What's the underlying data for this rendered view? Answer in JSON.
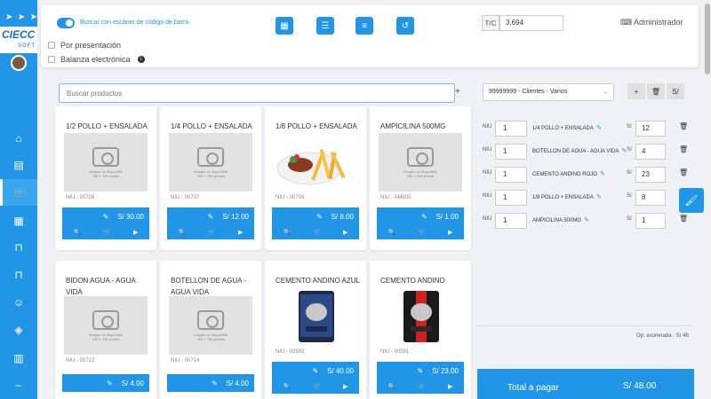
{
  "topbar": {
    "barcode_toggle_label": "Buscar con escáner de código de barra",
    "presentacion_label": "Por presentación",
    "balanza_label": "Balanza electrónica",
    "tc_label": "T/C",
    "tc_value": "3.694",
    "admin_label": "Administrador",
    "buttons": [
      "grid-view",
      "list-view",
      "detail-list",
      "undo"
    ]
  },
  "logo": {
    "line1": "CIECC",
    "line2": "SOFT"
  },
  "search": {
    "placeholder": "Buscar productos",
    "add": "+"
  },
  "products": [
    {
      "name": "1/2 POLLO + ENSALADA",
      "code": "NIU - 00709",
      "price": "S/ 30.00",
      "image": "placeholder"
    },
    {
      "name": "1/4 POLLO + ENSALADA",
      "code": "NIU - 00707",
      "price": "S/ 12.00",
      "image": "placeholder"
    },
    {
      "name": "1/8 POLLO + ENSALADA",
      "code": "NIU - 00708",
      "price": "S/ 8.00",
      "image": "food"
    },
    {
      "name": "AMPICILINA 500MG",
      "code": "NIU - AM500",
      "price": "S/ 1.00",
      "image": "placeholder"
    },
    {
      "name": "BIDON AGUA - AGUA VIDA",
      "code": "NIU - 00713",
      "price": "S/ 4.00",
      "image": "placeholder"
    },
    {
      "name": "BOTELLON DE AGUA - AGUA VIDA",
      "code": "NIU - 00714",
      "price": "S/ 4.00",
      "image": "placeholder"
    },
    {
      "name": "CEMENTO ANDINO AZUL",
      "code": "NIU - 00592",
      "price": "S/ 40.00",
      "image": "cement-blue"
    },
    {
      "name": "CEMENTO ANDINO ROJO",
      "code": "NIU - 00591",
      "price": "S/ 23.00",
      "image": "cement-red"
    }
  ],
  "placeholder_text": "Imagen no disponible\n750 x 750 pixeles",
  "client": {
    "selected": "99999999 - Clientes - Varios",
    "btn_add": "+",
    "btn_delete": "trash",
    "btn_currency": "S/"
  },
  "cart": {
    "items": [
      {
        "unit": "NIU",
        "qty": "1",
        "name": "1/4 POLLO + ENSALADA",
        "currency": "S/",
        "price": "12"
      },
      {
        "unit": "NIU",
        "qty": "1",
        "name": "BOTELLON DE AGUA - AGUA VIDA",
        "currency": "S/",
        "price": "4"
      },
      {
        "unit": "NIU",
        "qty": "1",
        "name": "CEMENTO ANDINO ROJO",
        "currency": "S/",
        "price": "23"
      },
      {
        "unit": "NIU",
        "qty": "1",
        "name": "1/8 POLLO + ENSALADA",
        "currency": "S/",
        "price": "8"
      },
      {
        "unit": "NIU",
        "qty": "1",
        "name": "AMPICILINA 500MG",
        "currency": "S/",
        "price": "1"
      }
    ],
    "op_exonerada": "Op. exonerada : S/ 48",
    "total_label": "Total a pagar",
    "total_value": "S/ 48.00"
  },
  "colors": {
    "primary": "#2196e6",
    "background": "#eef1f5"
  }
}
